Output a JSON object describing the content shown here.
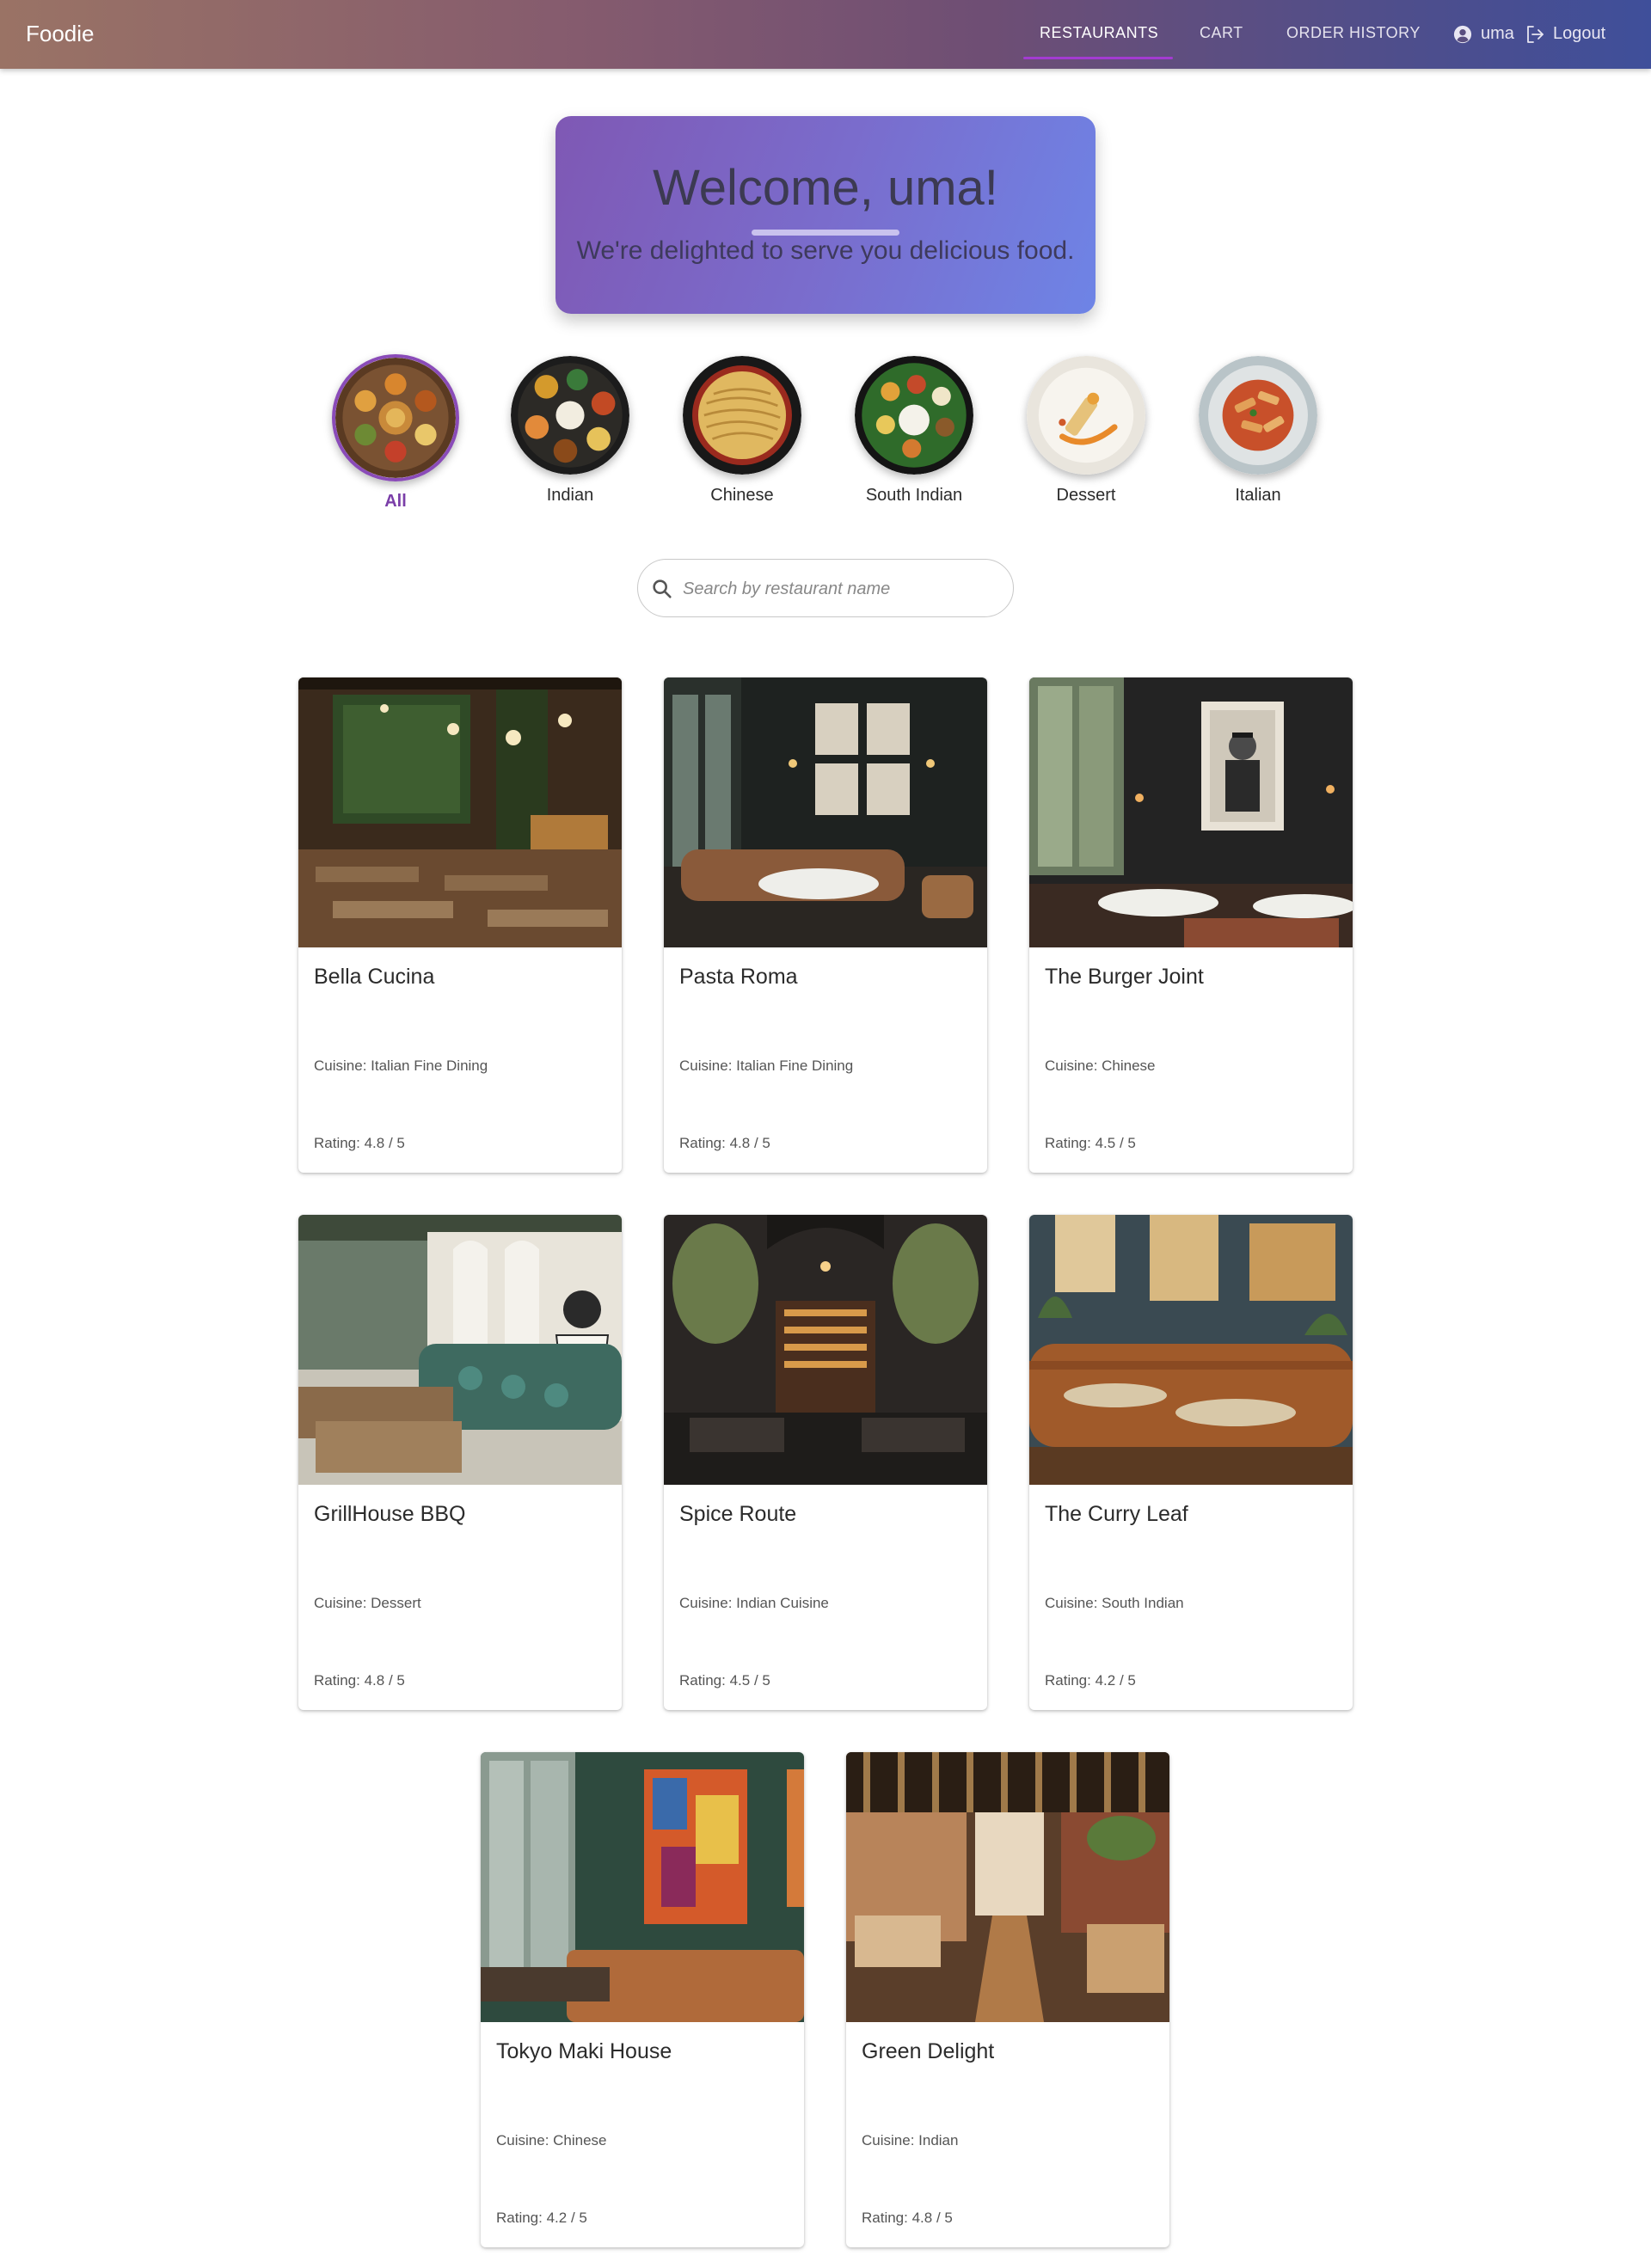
{
  "header": {
    "brand": "Foodie",
    "nav": [
      {
        "label": "RESTAURANTS",
        "active": true
      },
      {
        "label": "CART",
        "active": false
      },
      {
        "label": "ORDER HISTORY",
        "active": false
      }
    ],
    "user": "uma",
    "logout_label": "Logout"
  },
  "welcome": {
    "title": "Welcome, uma!",
    "subtitle": "We're delighted to serve you delicious food."
  },
  "categories": [
    {
      "label": "All",
      "active": true
    },
    {
      "label": "Indian",
      "active": false
    },
    {
      "label": "Chinese",
      "active": false
    },
    {
      "label": "South Indian",
      "active": false
    },
    {
      "label": "Dessert",
      "active": false
    },
    {
      "label": "Italian",
      "active": false
    }
  ],
  "search": {
    "placeholder": "Search by restaurant name",
    "value": ""
  },
  "restaurants": [
    {
      "name": "Bella Cucina",
      "cuisine": "Cuisine: Italian Fine Dining",
      "rating": "Rating: 4.8 / 5"
    },
    {
      "name": "Pasta Roma",
      "cuisine": "Cuisine: Italian Fine Dining",
      "rating": "Rating: 4.8 / 5"
    },
    {
      "name": "The Burger Joint",
      "cuisine": "Cuisine: Chinese",
      "rating": "Rating: 4.5 / 5"
    },
    {
      "name": "GrillHouse BBQ",
      "cuisine": "Cuisine: Dessert",
      "rating": "Rating: 4.8 / 5"
    },
    {
      "name": "Spice Route",
      "cuisine": "Cuisine: Indian Cuisine",
      "rating": "Rating: 4.5 / 5"
    },
    {
      "name": "The Curry Leaf",
      "cuisine": "Cuisine: South Indian",
      "rating": "Rating: 4.2 / 5"
    },
    {
      "name": "Tokyo Maki House",
      "cuisine": "Cuisine: Chinese",
      "rating": "Rating: 4.2 / 5"
    },
    {
      "name": "Green Delight",
      "cuisine": "Cuisine: Indian",
      "rating": "Rating: 4.8 / 5"
    }
  ],
  "colors": {
    "accent": "#8a4bb8",
    "welcome_gradient_start": "#7f58b4",
    "welcome_gradient_end": "#6e84e6"
  }
}
